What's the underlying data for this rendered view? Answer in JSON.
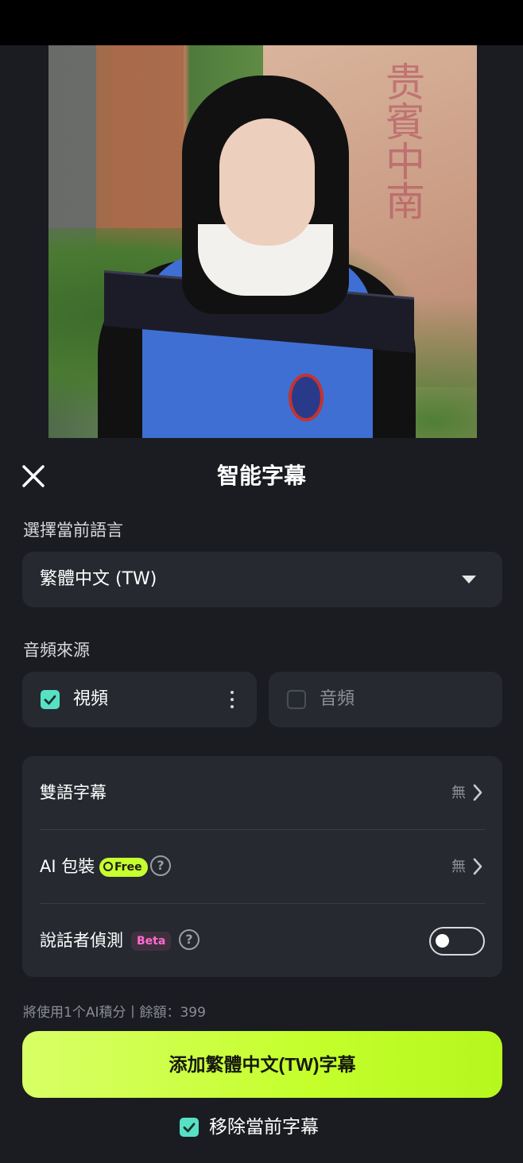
{
  "sheet": {
    "title": "智能字幕",
    "close_icon": "close-icon"
  },
  "language": {
    "section_label": "選擇當前語言",
    "selected": "繁體中文 (TW)"
  },
  "audio_source": {
    "section_label": "音頻來源",
    "options": [
      {
        "label": "視頻",
        "checked": true
      },
      {
        "label": "音頻",
        "checked": false
      }
    ]
  },
  "options": {
    "bilingual": {
      "label": "雙語字幕",
      "value": "無"
    },
    "ai_packaging": {
      "label": "AI 包裝",
      "badge": "Free",
      "value": "無"
    },
    "speaker_detection": {
      "label": "說話者偵測",
      "badge": "Beta",
      "enabled": false
    }
  },
  "credits_text": "將使用1个AI積分丨餘額：399",
  "primary_button": "添加繁體中文(TW)字幕",
  "remove_current": {
    "label": "移除當前字幕",
    "checked": true
  },
  "colors": {
    "accent": "#c4ff2c",
    "check": "#58e0c4",
    "beta": "#ff6bd2"
  }
}
